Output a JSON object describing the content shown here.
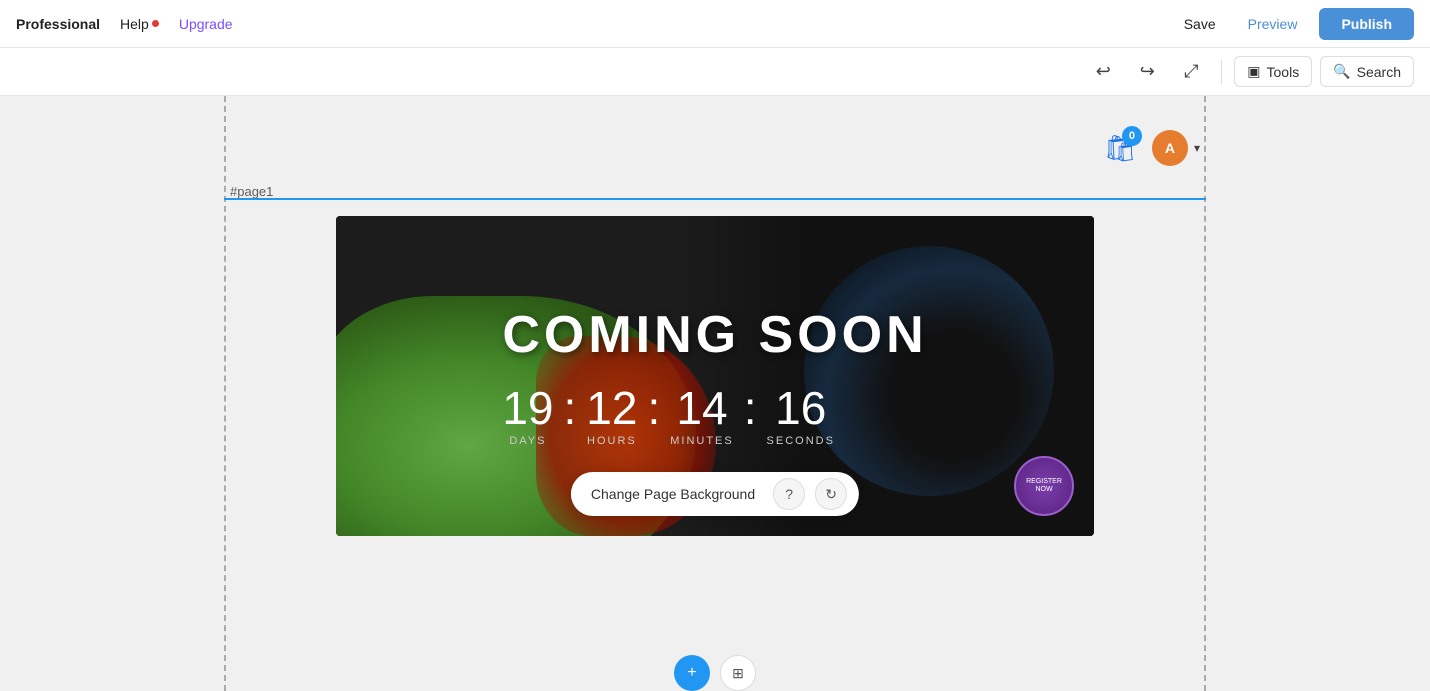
{
  "topbar": {
    "brand": "Professional",
    "help_label": "Help",
    "upgrade_label": "Upgrade",
    "save_label": "Save",
    "preview_label": "Preview",
    "publish_label": "Publish"
  },
  "toolbar2": {
    "tools_label": "Tools",
    "search_label": "Search"
  },
  "canvas": {
    "page_label": "#page1",
    "cart_count": "0",
    "user_initial": "A"
  },
  "banner": {
    "title": "COMING SOON",
    "countdown": {
      "days_value": "19",
      "days_label": "DAYS",
      "hours_value": "12",
      "hours_label": "HOURS",
      "minutes_value": "14",
      "minutes_label": "MINUTES",
      "seconds_value": "16",
      "seconds_label": "SECONDS",
      "sep1": ":",
      "sep2": ":",
      "sep3": ":"
    }
  },
  "bottom_toolbar": {
    "change_bg_label": "Change Page Background",
    "help_icon": "?",
    "refresh_icon": "↻"
  },
  "icons": {
    "undo": "↩",
    "redo": "↪",
    "compress": "⤡",
    "tools": "▣",
    "search": "🔍",
    "cart": "🛍",
    "chevron_down": "▾",
    "plus": "+",
    "grid": "⊞"
  }
}
